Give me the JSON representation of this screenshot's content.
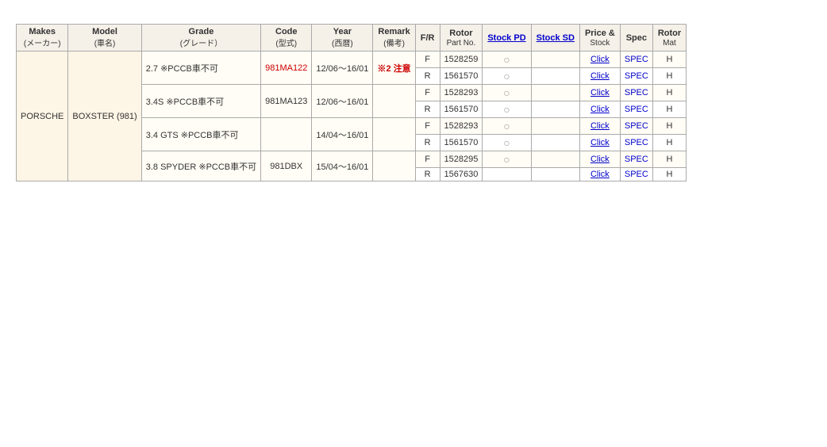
{
  "table": {
    "headers": {
      "makes": "Makes",
      "makes_sub": "(メーカー)",
      "model": "Model",
      "model_sub": "(車名)",
      "grade": "Grade",
      "grade_sub": "(グレード）",
      "code": "Code",
      "code_sub": "(型式)",
      "year": "Year",
      "year_sub": "(西暦)",
      "remark": "Remark",
      "remark_sub": "(備考)",
      "fr": "F/R",
      "rotor_part": "Rotor",
      "rotor_part_sub": "Part No.",
      "stock_pd": "Stock PD",
      "stock_sd": "Stock SD",
      "price_stock": "Price &",
      "price_stock_sub": "Stock",
      "spec": "Spec",
      "rotor_mat": "Rotor",
      "rotor_mat_sub": "Mat"
    },
    "rows": [
      {
        "makes": "PORSCHE",
        "model": "BOXSTER (981)",
        "grade": "2.7 ※PCCB車不可",
        "code": "981MA122",
        "code_red": true,
        "year": "12/06〜16/01",
        "remark": "※2 注意",
        "fr": "F",
        "rotor_part": "1528259",
        "stock_pd": "○",
        "stock_sd": "",
        "price_click": "Click",
        "spec": "SPEC",
        "rotor_mat": "H"
      },
      {
        "makes": "",
        "model": "",
        "grade": "",
        "code": "",
        "code_red": false,
        "year": "",
        "remark": "",
        "fr": "R",
        "rotor_part": "1561570",
        "stock_pd": "○",
        "stock_sd": "",
        "price_click": "Click",
        "spec": "SPEC",
        "rotor_mat": "H"
      },
      {
        "makes": "",
        "model": "",
        "grade": "3.4S ※PCCB車不可",
        "code": "981MA123",
        "code_red": false,
        "year": "12/06〜16/01",
        "remark": "",
        "fr": "F",
        "rotor_part": "1528293",
        "stock_pd": "○",
        "stock_sd": "",
        "price_click": "Click",
        "spec": "SPEC",
        "rotor_mat": "H"
      },
      {
        "makes": "",
        "model": "",
        "grade": "",
        "code": "",
        "code_red": false,
        "year": "",
        "remark": "",
        "fr": "R",
        "rotor_part": "1561570",
        "stock_pd": "○",
        "stock_sd": "",
        "price_click": "Click",
        "spec": "SPEC",
        "rotor_mat": "H"
      },
      {
        "makes": "",
        "model": "",
        "grade": "3.4 GTS ※PCCB車不可",
        "code": "",
        "code_red": false,
        "year": "14/04〜16/01",
        "remark": "",
        "fr": "F",
        "rotor_part": "1528293",
        "stock_pd": "○",
        "stock_sd": "",
        "price_click": "Click",
        "spec": "SPEC",
        "rotor_mat": "H"
      },
      {
        "makes": "",
        "model": "",
        "grade": "",
        "code": "",
        "code_red": false,
        "year": "",
        "remark": "",
        "fr": "R",
        "rotor_part": "1561570",
        "stock_pd": "○",
        "stock_sd": "",
        "price_click": "Click",
        "spec": "SPEC",
        "rotor_mat": "H"
      },
      {
        "makes": "",
        "model": "",
        "grade": "3.8 SPYDER ※PCCB車不可",
        "code": "981DBX",
        "code_red": false,
        "year": "15/04〜16/01",
        "remark": "",
        "fr": "F",
        "rotor_part": "1528295",
        "stock_pd": "○",
        "stock_sd": "",
        "price_click": "Click",
        "spec": "SPEC",
        "rotor_mat": "H"
      },
      {
        "makes": "",
        "model": "",
        "grade": "",
        "code": "",
        "code_red": false,
        "year": "",
        "remark": "",
        "fr": "R",
        "rotor_part": "1567630",
        "stock_pd": "",
        "stock_sd": "",
        "price_click": "Click",
        "spec": "SPEC",
        "rotor_mat": "H"
      }
    ]
  }
}
